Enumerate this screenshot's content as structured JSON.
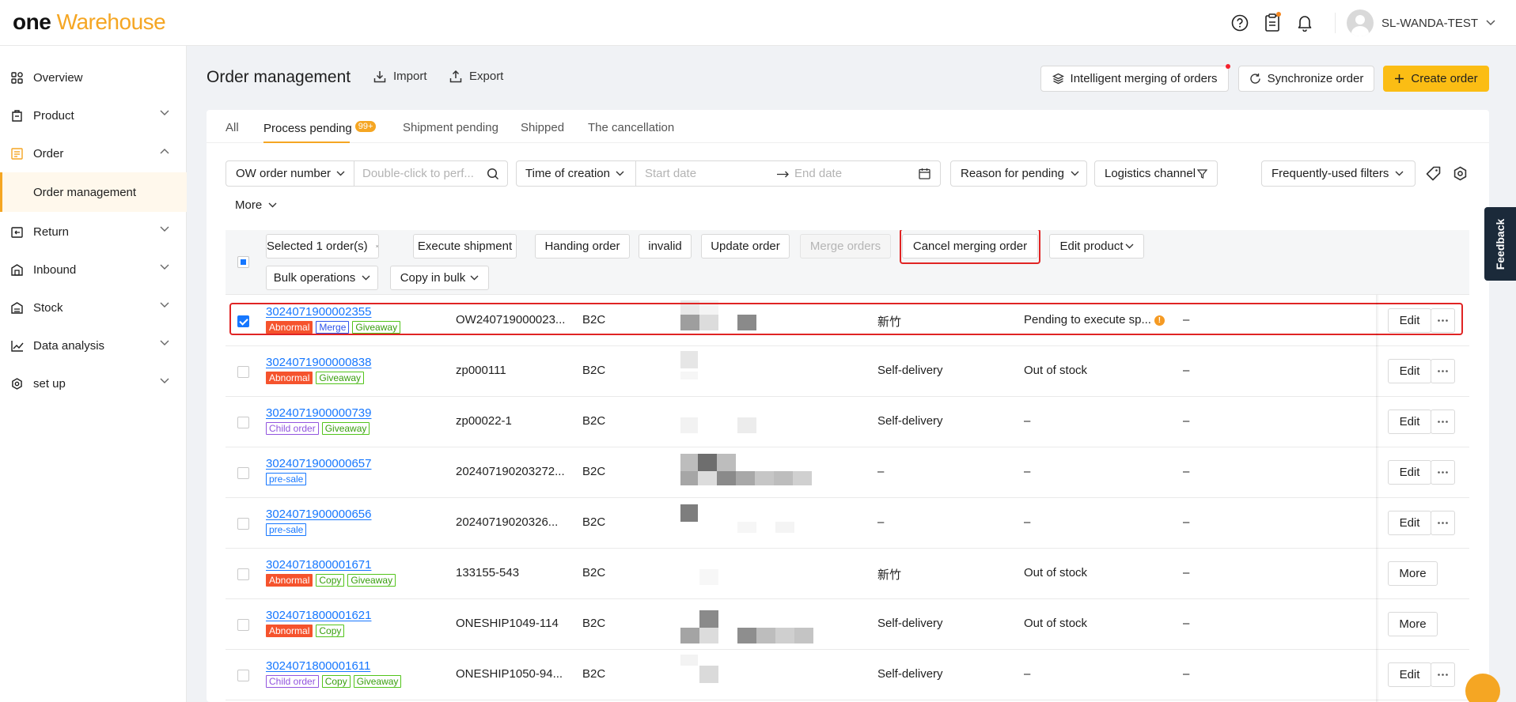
{
  "app": {
    "logo_one": "one",
    "logo_warehouse": "Warehouse",
    "username": "SL-WANDA-TEST"
  },
  "sidebar": {
    "items": [
      {
        "label": "Overview",
        "icon": "overview-icon"
      },
      {
        "label": "Product",
        "icon": "product-icon"
      },
      {
        "label": "Order",
        "icon": "order-icon"
      },
      {
        "label": "Return",
        "icon": "return-icon"
      },
      {
        "label": "Inbound",
        "icon": "inbound-icon"
      },
      {
        "label": "Stock",
        "icon": "stock-icon"
      },
      {
        "label": "Data analysis",
        "icon": "data-analysis-icon"
      },
      {
        "label": "set up",
        "icon": "setup-icon"
      }
    ],
    "sub_item": "Order management"
  },
  "header": {
    "title": "Order management",
    "import": "Import",
    "export": "Export",
    "intelligent_merge": "Intelligent merging of orders",
    "synchronize": "Synchronize order",
    "create": "Create order"
  },
  "tabs": [
    {
      "label": "All"
    },
    {
      "label": "Process pending",
      "badge": "99+"
    },
    {
      "label": "Shipment pending"
    },
    {
      "label": "Shipped"
    },
    {
      "label": "The cancellation"
    }
  ],
  "filters": {
    "ow_order_number": "OW order number",
    "search_placeholder": "Double-click to perf...",
    "time_of_creation": "Time of creation",
    "start_date": "Start date",
    "end_date": "End date",
    "reason_for_pending": "Reason for pending",
    "logistics_channel": "Logistics channel",
    "frequently_used": "Frequently-used filters",
    "more": "More"
  },
  "bulk": {
    "selected": "Selected 1 order(s)",
    "execute_shipment": "Execute shipment",
    "handing_order": "Handing order",
    "invalid": "invalid",
    "update_order": "Update order",
    "merge_orders": "Merge orders",
    "cancel_merging": "Cancel merging order",
    "edit_product": "Edit product",
    "bulk_operations": "Bulk operations",
    "copy_in_bulk": "Copy in bulk"
  },
  "rows": [
    {
      "order": "3024071900002355",
      "tags": [
        {
          "t": "Abnormal",
          "c": "abnormal"
        },
        {
          "t": "Merge",
          "c": "merge"
        },
        {
          "t": "Giveaway",
          "c": "giveaway"
        }
      ],
      "ref": "OW240719000023...",
      "type": "B2C",
      "channel": "新竹",
      "status": "Pending to execute sp...",
      "warn": true,
      "dash": "–",
      "action": "Edit",
      "more_dots": true,
      "checked": true
    },
    {
      "order": "3024071900000838",
      "tags": [
        {
          "t": "Abnormal",
          "c": "abnormal"
        },
        {
          "t": "Giveaway",
          "c": "giveaway"
        }
      ],
      "ref": "zp000111",
      "type": "B2C",
      "channel": "Self-delivery",
      "status": "Out of stock",
      "warn": false,
      "dash": "–",
      "action": "Edit",
      "more_dots": true,
      "checked": false
    },
    {
      "order": "3024071900000739",
      "tags": [
        {
          "t": "Child order",
          "c": "child"
        },
        {
          "t": "Giveaway",
          "c": "giveaway"
        }
      ],
      "ref": "zp00022-1",
      "type": "B2C",
      "channel": "Self-delivery",
      "status": "–",
      "warn": false,
      "dash": "–",
      "action": "Edit",
      "more_dots": true,
      "checked": false
    },
    {
      "order": "3024071900000657",
      "tags": [
        {
          "t": "pre-sale",
          "c": "presale"
        }
      ],
      "ref": "202407190203272...",
      "type": "B2C",
      "channel": "–",
      "status": "–",
      "warn": false,
      "dash": "–",
      "action": "Edit",
      "more_dots": true,
      "checked": false
    },
    {
      "order": "3024071900000656",
      "tags": [
        {
          "t": "pre-sale",
          "c": "presale"
        }
      ],
      "ref": "20240719020326...",
      "type": "B2C",
      "channel": "–",
      "status": "–",
      "warn": false,
      "dash": "–",
      "action": "Edit",
      "more_dots": true,
      "checked": false
    },
    {
      "order": "3024071800001671",
      "tags": [
        {
          "t": "Abnormal",
          "c": "abnormal"
        },
        {
          "t": "Copy",
          "c": "copy"
        },
        {
          "t": "Giveaway",
          "c": "giveaway"
        }
      ],
      "ref": "133155-543",
      "type": "B2C",
      "channel": "新竹",
      "status": "Out of stock",
      "warn": false,
      "dash": "–",
      "action": "More",
      "more_dots": false,
      "checked": false
    },
    {
      "order": "3024071800001621",
      "tags": [
        {
          "t": "Abnormal",
          "c": "abnormal"
        },
        {
          "t": "Copy",
          "c": "copy"
        }
      ],
      "ref": "ONESHIP1049-114",
      "type": "B2C",
      "channel": "Self-delivery",
      "status": "Out of stock",
      "warn": false,
      "dash": "–",
      "action": "More",
      "more_dots": false,
      "checked": false
    },
    {
      "order": "3024071800001611",
      "tags": [
        {
          "t": "Child order",
          "c": "child"
        },
        {
          "t": "Copy",
          "c": "copy"
        },
        {
          "t": "Giveaway",
          "c": "giveaway"
        }
      ],
      "ref": "ONESHIP1050-94...",
      "type": "B2C",
      "channel": "Self-delivery",
      "status": "–",
      "warn": false,
      "dash": "–",
      "action": "Edit",
      "more_dots": true,
      "checked": false
    }
  ],
  "feedback": "Feedback",
  "colors": {
    "accent": "#f5a623",
    "primary_button": "#fbbd14",
    "link": "#1677ff",
    "highlight_box": "#e02424"
  }
}
